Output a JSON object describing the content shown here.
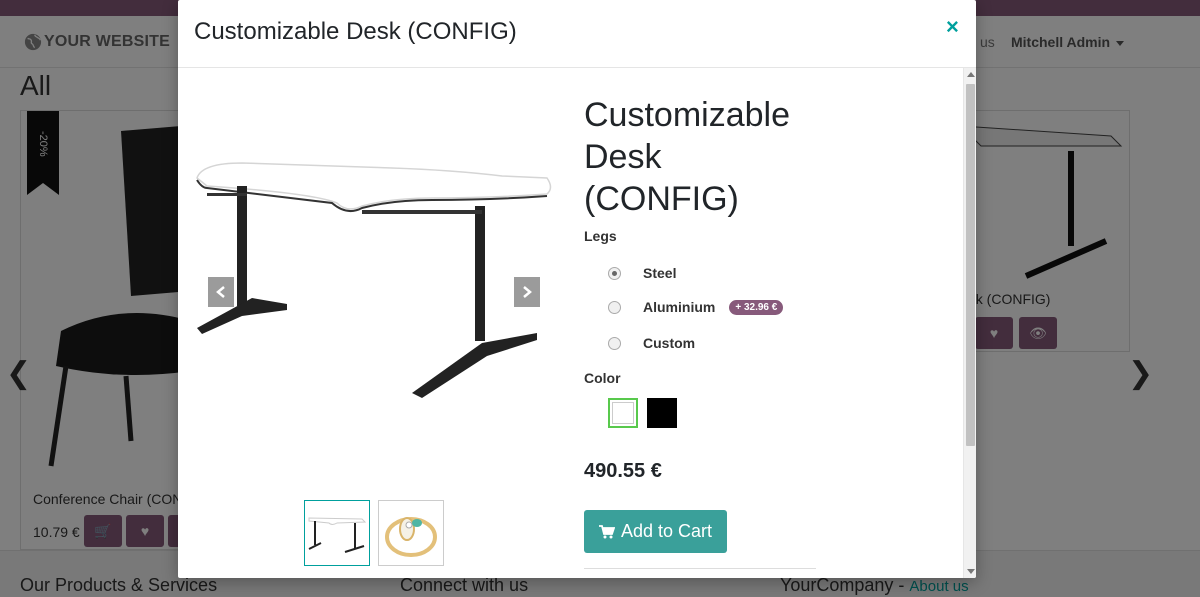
{
  "background": {
    "logo_text": "YOUR WEBSITE",
    "nav_partial": "us",
    "user_menu": "Mitchell Admin",
    "page_title": "All",
    "left_card": {
      "ribbon": "-20%",
      "name": "Conference Chair (CON",
      "price": "10.79 €"
    },
    "right_card": {
      "name": "esk (CONFIG)"
    },
    "carousel_prev": "❮",
    "carousel_next": "❯",
    "footer": {
      "col1": "Our Products & Services",
      "col2": "Connect with us",
      "col3": "YourCompany",
      "col3_sep": " - ",
      "col3_link": "About us"
    }
  },
  "modal": {
    "title": "Customizable Desk (CONFIG)",
    "close_label": "×",
    "product": {
      "name": "Customizable Desk (CONFIG)",
      "legs_label": "Legs",
      "legs_options": [
        {
          "label": "Steel",
          "checked": true
        },
        {
          "label": "Aluminium",
          "badge": "+ 32.96 €",
          "checked": false
        },
        {
          "label": "Custom",
          "checked": false
        }
      ],
      "color_label": "Color",
      "colors": [
        "#ffffff",
        "#000000"
      ],
      "selected_color": "#ffffff",
      "price": "490.55 €",
      "add_to_cart_label": "Add to Cart"
    }
  },
  "colors": {
    "brand": "#875a7b",
    "accent": "#00A09D",
    "cart_button": "#3aa09a",
    "selected_swatch_border": "#58c94c"
  }
}
